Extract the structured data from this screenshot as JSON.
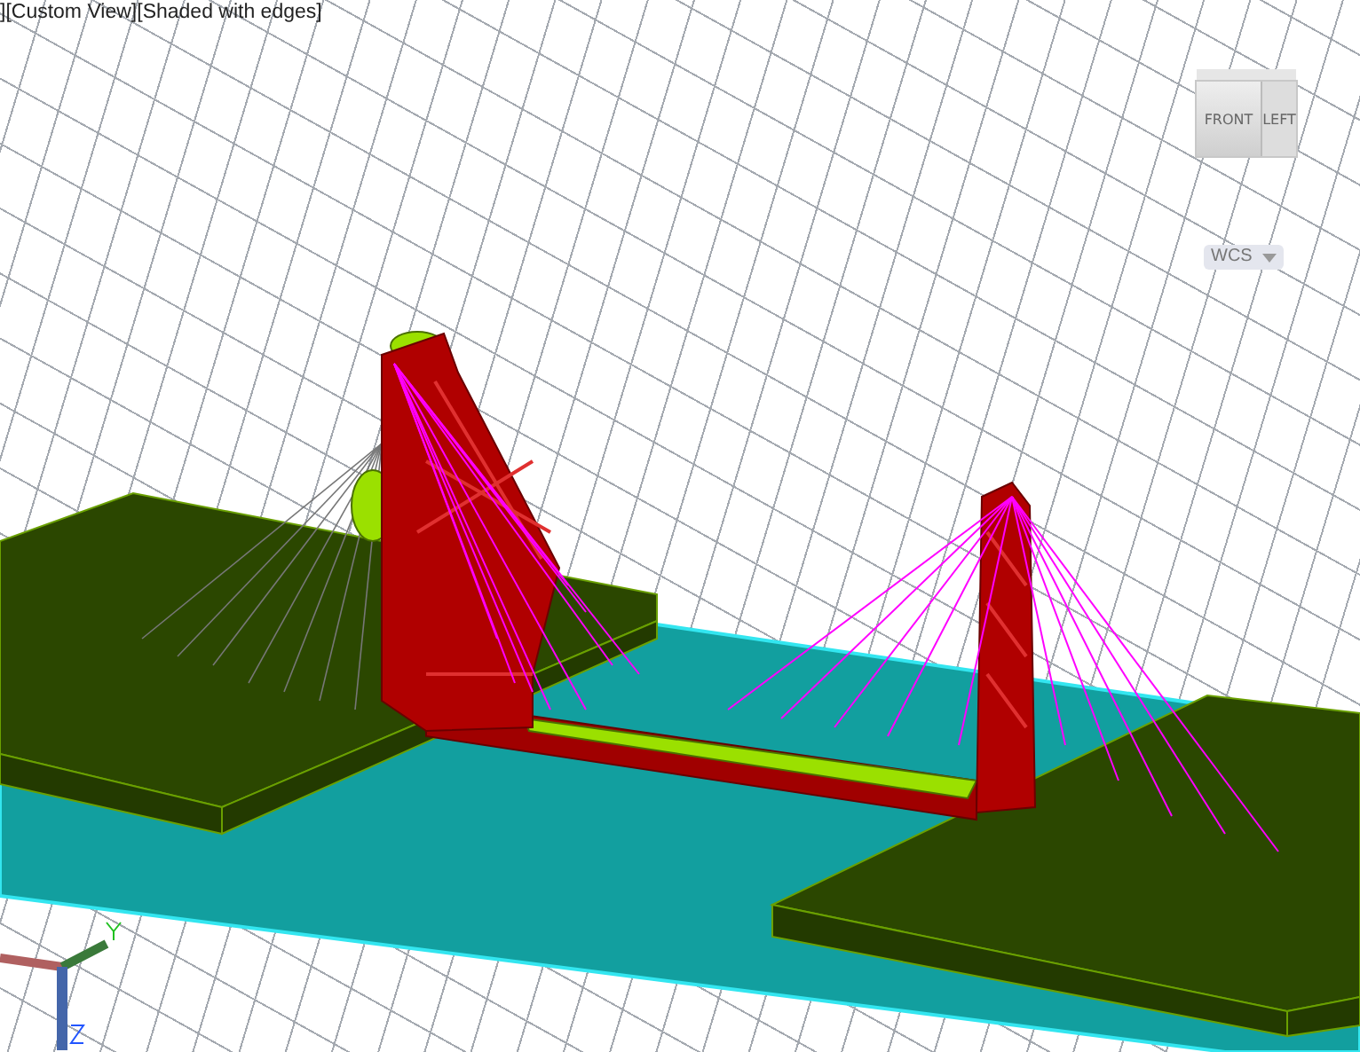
{
  "viewport": {
    "label": "][Custom View][Shaded with edges]"
  },
  "viewcube": {
    "faces": [
      {
        "label": "FRONT"
      },
      {
        "label": "LEFT"
      }
    ]
  },
  "wcs_button": {
    "label": "WCS"
  }
}
